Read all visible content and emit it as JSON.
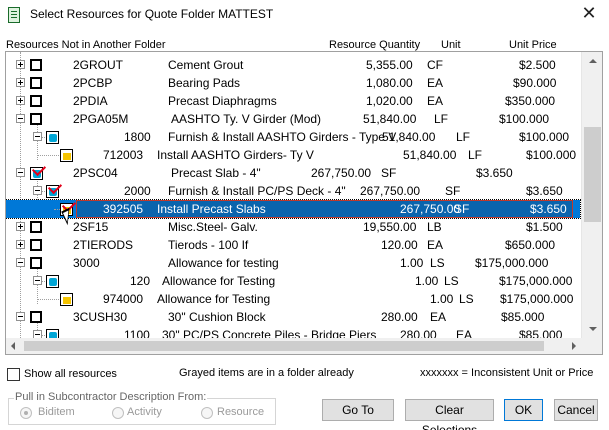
{
  "window": {
    "title": "Select Resources for Quote Folder MATTEST",
    "close_glyph": "✕"
  },
  "columns": {
    "resource": "Resources Not in Another Folder",
    "quantity": "Resource Quantity",
    "unit": "Unit",
    "price": "Unit Price"
  },
  "rows": [
    {
      "code": "2GROUT",
      "desc": "Cement Grout",
      "qty": "5,355.00",
      "unit": "CF",
      "price": "$2.500"
    },
    {
      "code": "2PCBP",
      "desc": "Bearing Pads",
      "qty": "1,080.00",
      "unit": "EA",
      "price": "$90.000"
    },
    {
      "code": "2PDIA",
      "desc": "Precast Diaphragms",
      "qty": "1,020.00",
      "unit": "EA",
      "price": "$350.000"
    },
    {
      "code": "2PGA05M",
      "desc": "AASHTO Ty. V Girder (Mod)",
      "qty": "51,840.00",
      "unit": "LF",
      "price": "$100.000"
    },
    {
      "code": "1800",
      "desc": "Furnish & Install AASHTO Girders - Type V",
      "qty": "51,840.00",
      "unit": "LF",
      "price": "$100.000"
    },
    {
      "code": "712003",
      "desc": "Install AASHTO Girders- Ty V",
      "qty": "51,840.00",
      "unit": "LF",
      "price": "$100.000"
    },
    {
      "code": "2PSC04",
      "desc": "Precast Slab - 4\"",
      "qty": "267,750.00",
      "unit": "SF",
      "price": "$3.650"
    },
    {
      "code": "2000",
      "desc": "Furnish & Install PC/PS Deck - 4\"",
      "qty": "267,750.00",
      "unit": "SF",
      "price": "$3.650"
    },
    {
      "code": "392505",
      "desc": "Install Precast Slabs",
      "qty": "267,750.00",
      "unit": "SF",
      "price": "$3.650"
    },
    {
      "code": "2SF15",
      "desc": "Misc.Steel- Galv.",
      "qty": "19,550.00",
      "unit": "LB",
      "price": "$1.500"
    },
    {
      "code": "2TIERODS",
      "desc": "Tierods - 100 If",
      "qty": "120.00",
      "unit": "EA",
      "price": "$650.000"
    },
    {
      "code": "3000",
      "desc": "Allowance for testing",
      "qty": "1.00",
      "unit": "LS",
      "price": "$175,000.000"
    },
    {
      "code": "120",
      "desc": "Allowance for Testing",
      "qty": "1.00",
      "unit": "LS",
      "price": "$175,000.000"
    },
    {
      "code": "974000",
      "desc": "Allowance for Testing",
      "qty": "1.00",
      "unit": "LS",
      "price": "$175,000.000"
    },
    {
      "code": "3CUSH30",
      "desc": "30\" Cushion Block",
      "qty": "280.00",
      "unit": "EA",
      "price": "$85.000"
    },
    {
      "code": "1100",
      "desc": "30\" PC/PS Concrete Piles - Bridge Piers",
      "qty": "280.00",
      "unit": "EA",
      "price": "$85.000"
    }
  ],
  "footer": {
    "show_all": "Show all resources",
    "grayed_note": "Grayed items are in a folder already",
    "inconsistent_note": "xxxxxxx = Inconsistent Unit or Price",
    "pull_label": "Pull in Subcontractor Description From:",
    "radio_biditem": "Biditem",
    "radio_activity": "Activity",
    "radio_resource": "Resource"
  },
  "buttons": {
    "goto": "Go To",
    "clear": "Clear Selections",
    "ok": "OK",
    "cancel": "Cancel"
  }
}
